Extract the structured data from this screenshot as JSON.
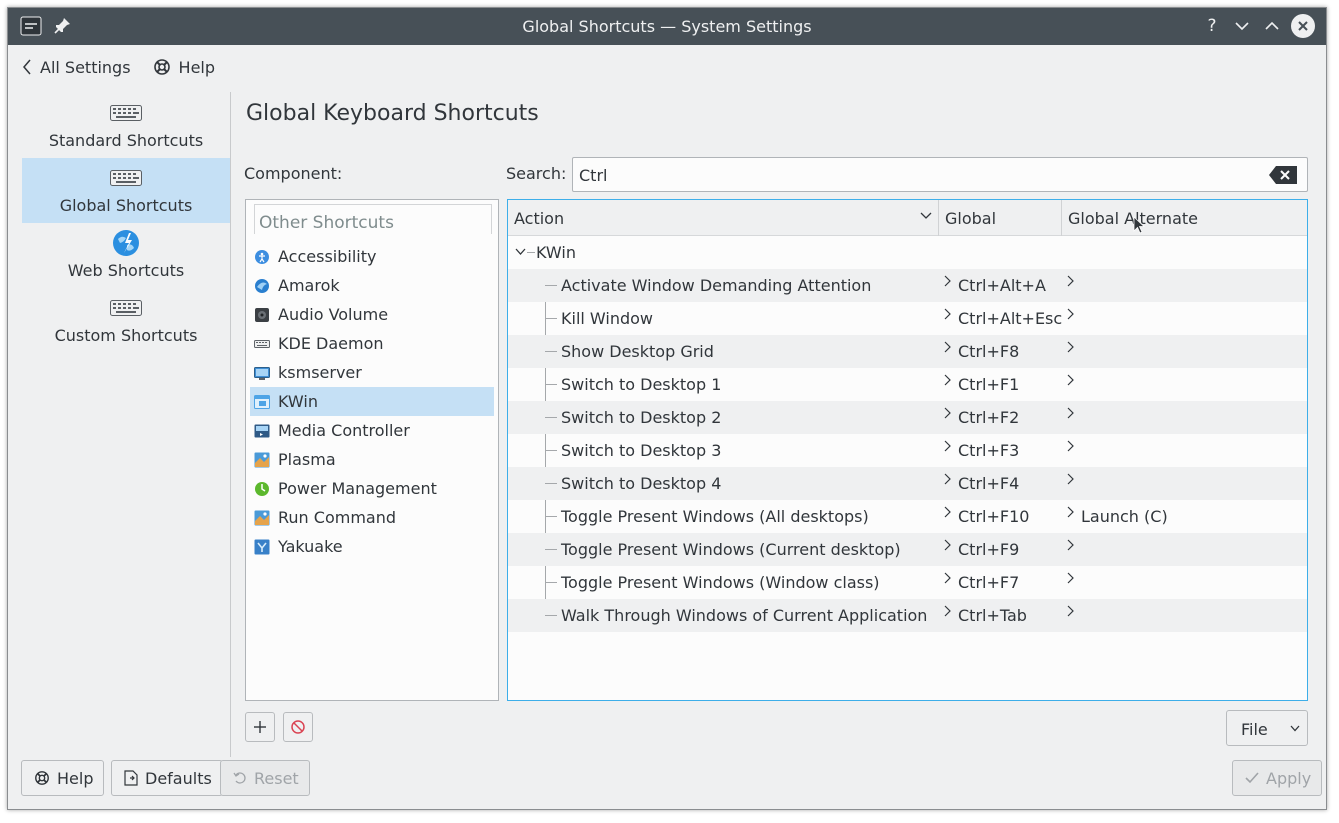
{
  "window": {
    "title": "Global Shortcuts — System Settings",
    "titlebar_buttons": [
      "?",
      "minimize",
      "maximize",
      "close"
    ]
  },
  "toolbar": {
    "back_label": "All Settings",
    "help_label": "Help"
  },
  "sidebar": {
    "items": [
      {
        "label": "Standard Shortcuts",
        "icon": "keyboard-icon",
        "active": false
      },
      {
        "label": "Global Shortcuts",
        "icon": "keyboard-icon",
        "active": true
      },
      {
        "label": "Web Shortcuts",
        "icon": "web-globe-icon",
        "active": false
      },
      {
        "label": "Custom Shortcuts",
        "icon": "keyboard-icon",
        "active": false
      }
    ]
  },
  "main": {
    "title": "Global Keyboard Shortcuts",
    "component_label": "Component:",
    "search_label": "Search:",
    "search_value": "Ctrl"
  },
  "components": {
    "header": "Other Shortcuts",
    "items": [
      {
        "label": "Accessibility",
        "icon": "accessibility-icon",
        "color": "#3d8ee0"
      },
      {
        "label": "Amarok",
        "icon": "amarok-icon",
        "color": "#2a7fcf"
      },
      {
        "label": "Audio Volume",
        "icon": "audio-volume-icon",
        "color": "#3b3f44"
      },
      {
        "label": "KDE Daemon",
        "icon": "kde-daemon-icon",
        "color": "#5e6368"
      },
      {
        "label": "ksmserver",
        "icon": "ksmserver-icon",
        "color": "#3f8fd6"
      },
      {
        "label": "KWin",
        "icon": "kwin-icon",
        "color": "#4ea4e6",
        "active": true
      },
      {
        "label": "Media Controller",
        "icon": "media-controller-icon",
        "color": "#2f5a86"
      },
      {
        "label": "Plasma",
        "icon": "plasma-icon",
        "color": "#4a9ad8"
      },
      {
        "label": "Power Management",
        "icon": "power-management-icon",
        "color": "#5cb82d"
      },
      {
        "label": "Run Command",
        "icon": "run-command-icon",
        "color": "#4a9ad8"
      },
      {
        "label": "Yakuake",
        "icon": "yakuake-icon",
        "color": "#3880c8"
      }
    ]
  },
  "shortcuts": {
    "columns": [
      "Action",
      "Global",
      "Global Alternate"
    ],
    "group": "KWin",
    "rows": [
      {
        "action": "Activate Window Demanding Attention",
        "global": "Ctrl+Alt+A",
        "alternate": ""
      },
      {
        "action": "Kill Window",
        "global": "Ctrl+Alt+Esc",
        "alternate": ""
      },
      {
        "action": "Show Desktop Grid",
        "global": "Ctrl+F8",
        "alternate": ""
      },
      {
        "action": "Switch to Desktop 1",
        "global": "Ctrl+F1",
        "alternate": ""
      },
      {
        "action": "Switch to Desktop 2",
        "global": "Ctrl+F2",
        "alternate": ""
      },
      {
        "action": "Switch to Desktop 3",
        "global": "Ctrl+F3",
        "alternate": ""
      },
      {
        "action": "Switch to Desktop 4",
        "global": "Ctrl+F4",
        "alternate": ""
      },
      {
        "action": "Toggle Present Windows (All desktops)",
        "global": "Ctrl+F10",
        "alternate": "Launch (C)"
      },
      {
        "action": "Toggle Present Windows (Current desktop)",
        "global": "Ctrl+F9",
        "alternate": ""
      },
      {
        "action": "Toggle Present Windows (Window class)",
        "global": "Ctrl+F7",
        "alternate": ""
      },
      {
        "action": "Walk Through Windows of Current Application",
        "global": "Ctrl+Tab",
        "alternate": ""
      }
    ]
  },
  "bottom": {
    "file_label": "File",
    "help_label": "Help",
    "defaults_label": "Defaults",
    "reset_label": "Reset",
    "apply_label": "Apply"
  },
  "colors": {
    "selection": "#c5e0f5",
    "focus": "#3daee9",
    "titlebar": "#475057"
  }
}
